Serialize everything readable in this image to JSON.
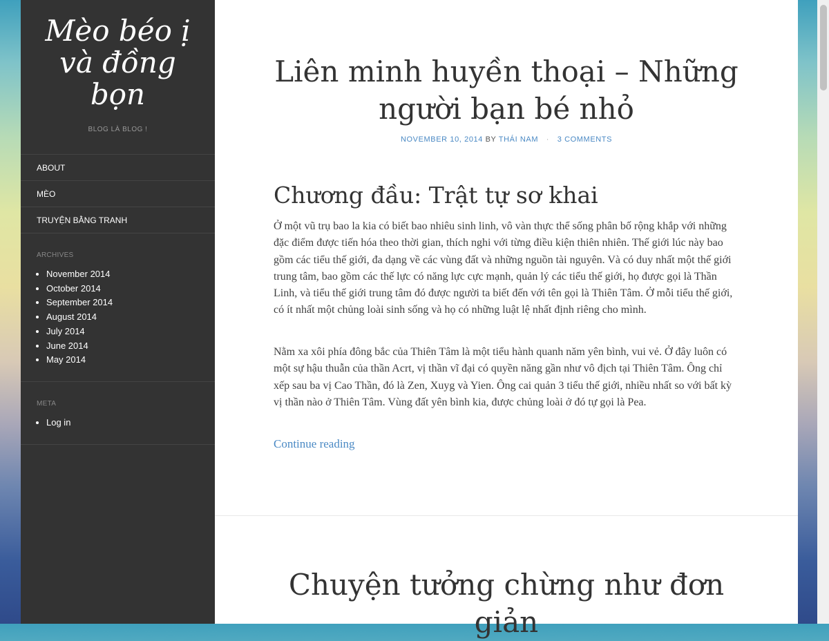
{
  "site": {
    "title": "Mèo béo ị và đồng bọn",
    "description": "BLOG LÀ BLOG !"
  },
  "menu": [
    "ABOUT",
    "MÈO",
    "TRUYỆN BẰNG TRANH"
  ],
  "archives": {
    "title": "ARCHIVES",
    "items": [
      "November 2014",
      "October 2014",
      "September 2014",
      "August 2014",
      "July 2014",
      "June 2014",
      "May 2014"
    ]
  },
  "meta_widget": {
    "title": "META",
    "items": [
      "Log in"
    ]
  },
  "post1": {
    "title": "Liên minh huyền thoại – Những người bạn bé nhỏ",
    "date": "NOVEMBER 10, 2014",
    "by": "BY",
    "author": "THÁI NAM",
    "comments": "3 COMMENTS",
    "chapter": "Chương đầu: Trật tự sơ khai",
    "para1": "Ở một vũ trụ bao la kia có biết bao nhiêu sinh linh, vô vàn thực thể sống phân bố rộng khắp với những đặc điểm được tiến hóa theo thời gian, thích nghi với từng điều kiện thiên nhiên. Thế giới lúc này bao gồm các tiểu thế giới, đa dạng về các vùng đất và những nguồn tài nguyên. Và có duy nhất một thế giới trung tâm, bao gồm các thế lực có năng lực cực mạnh, quản lý các tiểu thế giới, họ được gọi là Thần Linh, và tiểu thế giới trung tâm đó được người ta biết đến với tên gọi là Thiên Tâm. Ở mỗi tiểu thế giới, có ít nhất một chủng loài sinh sống và họ có những luật lệ nhất định riêng cho mình.",
    "para2": "Nằm xa xôi phía đông bắc của Thiên Tâm là một tiểu hành quanh năm yên bình, vui vẻ. Ở đây luôn có một sự hậu thuẫn của thần Acrt, vị thần vĩ đại có quyền năng gần như vô địch tại Thiên Tâm. Ông chỉ xếp sau ba vị Cao Thần, đó là Zen, Xuyg và Yien. Ông cai quản 3 tiểu thế giới, nhiều nhất so với bất kỳ vị thần nào ở Thiên Tâm. Vùng đất yên bình kia, được chủng loài ở đó tự gọi là Pea.",
    "continue": "Continue reading"
  },
  "post2": {
    "title": "Chuyện tưởng chừng như đơn giản"
  }
}
